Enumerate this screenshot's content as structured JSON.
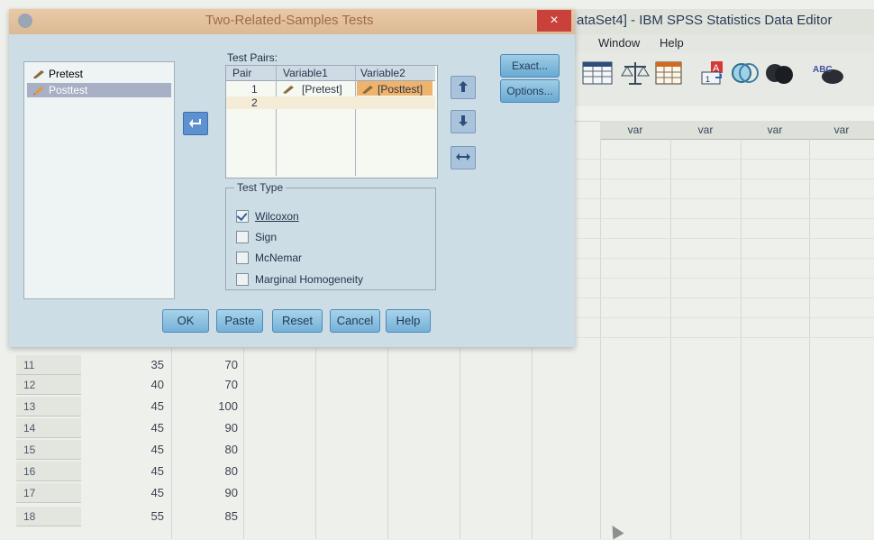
{
  "editor": {
    "title": "ataSet4] - IBM SPSS Statistics Data Editor",
    "menu": [
      "Window",
      "Help"
    ],
    "var_headers": [
      "var",
      "var",
      "var",
      "var"
    ],
    "rows": [
      {
        "num": "11",
        "pretest": "35",
        "posttest": "70"
      },
      {
        "num": "12",
        "pretest": "40",
        "posttest": "70"
      },
      {
        "num": "13",
        "pretest": "45",
        "posttest": "100"
      },
      {
        "num": "14",
        "pretest": "45",
        "posttest": "90"
      },
      {
        "num": "15",
        "pretest": "45",
        "posttest": "80"
      },
      {
        "num": "16",
        "pretest": "45",
        "posttest": "80"
      },
      {
        "num": "17",
        "pretest": "45",
        "posttest": "90"
      },
      {
        "num": "18",
        "pretest": "55",
        "posttest": "85"
      }
    ],
    "toolbar_icons": [
      "data-grid-icon",
      "balance-scale-icon",
      "table-grid-icon",
      "split-file-icon",
      "venn-diagram-icon",
      "circles-icon",
      "abc-label-icon"
    ],
    "abc": "ABC"
  },
  "dialog": {
    "title": "Two-Related-Samples Tests",
    "close": "×",
    "variables": [
      "Pretest",
      "Posttest"
    ],
    "test_pairs_label": "Test Pairs:",
    "pair_headers": {
      "pair": "Pair",
      "var1": "Variable1",
      "var2": "Variable2"
    },
    "pairs": [
      {
        "pair": "1",
        "var1": "[Pretest]",
        "var2": "[Posttest]"
      },
      {
        "pair": "2",
        "var1": "",
        "var2": ""
      }
    ],
    "test_type": {
      "legend": "Test Type",
      "options": [
        {
          "label": "Wilcoxon",
          "checked": true
        },
        {
          "label": "Sign",
          "checked": false
        },
        {
          "label": "McNemar",
          "checked": false
        },
        {
          "label": "Marginal Homogeneity",
          "checked": false
        }
      ]
    },
    "buttons": {
      "exact": "Exact...",
      "options": "Options...",
      "ok": "OK",
      "paste": "Paste",
      "reset": "Reset",
      "cancel": "Cancel",
      "help": "Help"
    }
  }
}
